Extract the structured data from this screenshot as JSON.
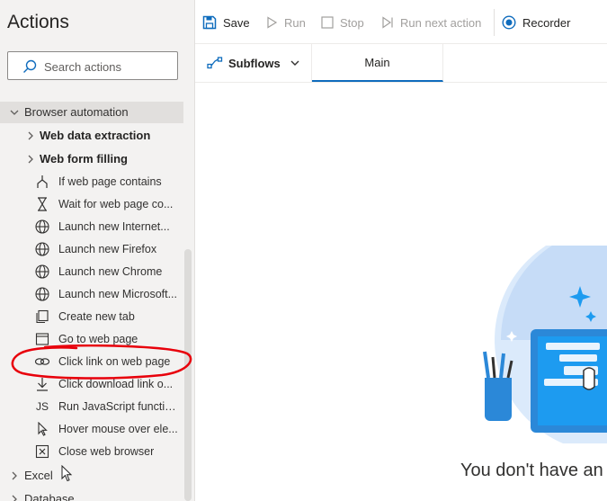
{
  "actions_panel": {
    "title": "Actions",
    "search": {
      "placeholder": "Search actions",
      "value": ""
    },
    "category": {
      "label": "Browser automation",
      "expanded": true
    },
    "subcategories": [
      {
        "label": "Web data extraction"
      },
      {
        "label": "Web form filling"
      }
    ],
    "actions": [
      {
        "label": "If web page contains",
        "icon": "branch-icon"
      },
      {
        "label": "Wait for web page co...",
        "icon": "hourglass-icon"
      },
      {
        "label": "Launch new Internet...",
        "icon": "globe-icon"
      },
      {
        "label": "Launch new Firefox",
        "icon": "globe-icon"
      },
      {
        "label": "Launch new Chrome",
        "icon": "globe-icon"
      },
      {
        "label": "Launch new Microsoft...",
        "icon": "globe-icon"
      },
      {
        "label": "Create new tab",
        "icon": "new-tab-icon"
      },
      {
        "label": "Go to web page",
        "icon": "web-page-icon"
      },
      {
        "label": "Click link on web page",
        "icon": "link-icon"
      },
      {
        "label": "Click download link o...",
        "icon": "download-icon"
      },
      {
        "label": "Run JavaScript functio...",
        "icon": "js-icon",
        "glyph": "JS"
      },
      {
        "label": "Hover mouse over ele...",
        "icon": "pointer-icon"
      },
      {
        "label": "Close web browser",
        "icon": "close-box-icon"
      }
    ],
    "groups": [
      {
        "label": "Excel"
      },
      {
        "label": "Database"
      }
    ]
  },
  "toolbar": {
    "save_label": "Save",
    "run_label": "Run",
    "stop_label": "Stop",
    "run_next_label": "Run next action",
    "recorder_label": "Recorder"
  },
  "tabs": {
    "subflows_label": "Subflows",
    "main_label": "Main"
  },
  "canvas": {
    "empty_message": "You don't have an"
  },
  "colors": {
    "accent": "#0f6cbd",
    "annotation": "#e8000b",
    "panel_bg": "#f3f2f1"
  }
}
